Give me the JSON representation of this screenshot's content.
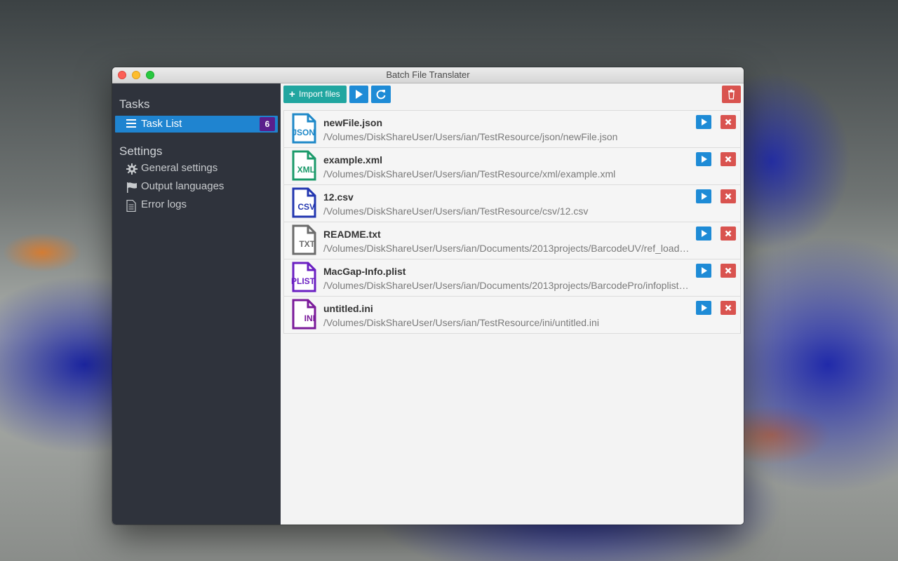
{
  "window": {
    "title": "Batch File Translater"
  },
  "sidebar": {
    "tasks_title": "Tasks",
    "task_list": {
      "label": "Task List",
      "count": "6"
    },
    "settings_title": "Settings",
    "items": [
      {
        "label": "General settings",
        "icon": "gear-icon"
      },
      {
        "label": "Output languages",
        "icon": "flag-icon"
      },
      {
        "label": "Error logs",
        "icon": "document-icon"
      }
    ]
  },
  "toolbar": {
    "import_label": "Import files",
    "colors": {
      "import": "#21a6a0",
      "primary": "#1e8bd6",
      "danger": "#d9534f"
    }
  },
  "files": [
    {
      "name": "newFile.json",
      "path": "/Volumes/DiskShareUser/Users/ian/TestResource/json/newFile.json",
      "type": "JSON",
      "color": "#1e88c8"
    },
    {
      "name": "example.xml",
      "path": "/Volumes/DiskShareUser/Users/ian/TestResource/xml/example.xml",
      "type": "XML",
      "color": "#1b9a6a"
    },
    {
      "name": "12.csv",
      "path": "/Volumes/DiskShareUser/Users/ian/TestResource/csv/12.csv",
      "type": "CSV",
      "color": "#2236b0"
    },
    {
      "name": "README.txt",
      "path": "/Volumes/DiskShareUser/Users/ian/Documents/2013projects/BarcodeUV/ref_load…",
      "type": "TXT",
      "color": "#6b6b6b"
    },
    {
      "name": "MacGap-Info.plist",
      "path": "/Volumes/DiskShareUser/Users/ian/Documents/2013projects/BarcodePro/infoplist…",
      "type": "PLIST",
      "color": "#6a1fc2"
    },
    {
      "name": "untitled.ini",
      "path": "/Volumes/DiskShareUser/Users/ian/TestResource/ini/untitled.ini",
      "type": "INI",
      "color": "#7a1a9a"
    }
  ]
}
